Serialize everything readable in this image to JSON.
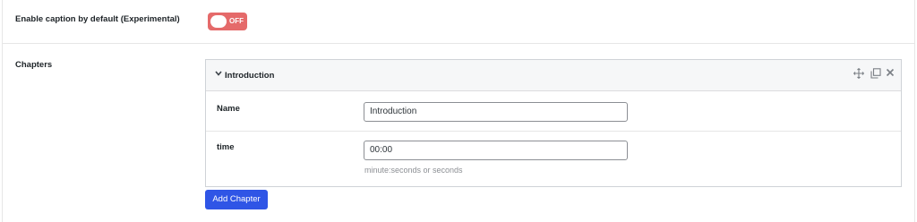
{
  "caption_row": {
    "label": "Enable caption by default (Experimental)",
    "toggle_state": "OFF",
    "toggle_color": "#e56a6a"
  },
  "chapters_row": {
    "label": "Chapters",
    "chapter": {
      "title": "Introduction",
      "icons": [
        "chevron-down-icon",
        "move-icon",
        "duplicate-icon",
        "close-icon"
      ],
      "fields": {
        "name_label": "Name",
        "name_value": "Introduction",
        "time_label": "time",
        "time_value": "00:00",
        "time_hint": "minute:seconds or seconds"
      }
    },
    "add_button_label": "Add Chapter",
    "add_button_color": "#2f55e6"
  }
}
